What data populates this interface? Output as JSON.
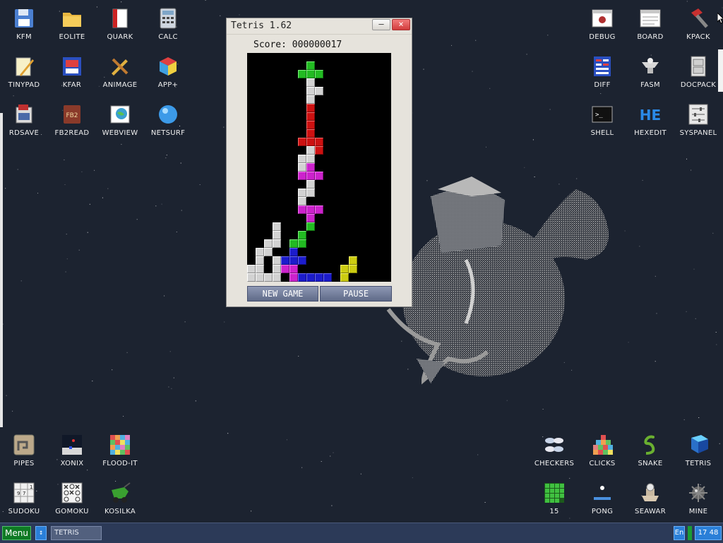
{
  "desktop": {
    "icons_top_left": [
      {
        "label": "KFM",
        "icon": "floppy-disk-icon"
      },
      {
        "label": "EOLITE",
        "icon": "folder-icon"
      },
      {
        "label": "QUARK",
        "icon": "red-book-icon"
      },
      {
        "label": "CALC",
        "icon": "calculator-icon"
      },
      {
        "label": "TINYPAD",
        "icon": "notepad-pencil-icon"
      },
      {
        "label": "KFAR",
        "icon": "archive-grid-icon"
      },
      {
        "label": "ANIMAGE",
        "icon": "pencil-ruler-icon"
      },
      {
        "label": "APP+",
        "icon": "rubik-cube-icon"
      },
      {
        "label": "RDSAVE",
        "icon": "ram-disk-icon"
      },
      {
        "label": "FB2READ",
        "icon": "fb2-book-icon"
      },
      {
        "label": "WEBVIEW",
        "icon": "web-image-icon"
      },
      {
        "label": "NETSURF",
        "icon": "globe-icon"
      }
    ],
    "icons_top_right": [
      {
        "label": "DEBUG",
        "icon": "bug-window-icon"
      },
      {
        "label": "BOARD",
        "icon": "board-window-icon"
      },
      {
        "label": "KPACK",
        "icon": "hammer-icon"
      },
      {
        "label": "DIFF",
        "icon": "diff-table-icon"
      },
      {
        "label": "FASM",
        "icon": "fasm-anvil-icon"
      },
      {
        "label": "DOCPACK",
        "icon": "cabinet-icon"
      },
      {
        "label": "SHELL",
        "icon": "terminal-icon"
      },
      {
        "label": "HEXEDIT",
        "icon": "hex-editor-icon"
      },
      {
        "label": "SYSPANEL",
        "icon": "sliders-panel-icon"
      }
    ],
    "icons_bottom_left": [
      {
        "label": "PIPES",
        "icon": "pipes-game-icon"
      },
      {
        "label": "XONIX",
        "icon": "xonix-game-icon"
      },
      {
        "label": "FLOOD-IT",
        "icon": "flood-it-game-icon"
      },
      {
        "label": "SUDOKU",
        "icon": "sudoku-grid-icon"
      },
      {
        "label": "GOMOKU",
        "icon": "gomoku-board-icon"
      },
      {
        "label": "KOSILKA",
        "icon": "lawnmower-icon"
      }
    ],
    "icons_bottom_right": [
      {
        "label": "CHECKERS",
        "icon": "checkers-pieces-icon"
      },
      {
        "label": "CLICKS",
        "icon": "clicks-blocks-icon"
      },
      {
        "label": "SNAKE",
        "icon": "snake-icon"
      },
      {
        "label": "TETRIS",
        "icon": "tetris-cube-icon"
      },
      {
        "label": "15",
        "icon": "fifteen-puzzle-icon"
      },
      {
        "label": "PONG",
        "icon": "pong-paddle-icon"
      },
      {
        "label": "SEAWAR",
        "icon": "seawar-ship-icon"
      },
      {
        "label": "MINE",
        "icon": "mine-icon"
      }
    ]
  },
  "tetris_window": {
    "title": "Tetris 1.62",
    "minimize_label": "–",
    "close_label": "×",
    "score_label": "Score:",
    "score_value": "000000017",
    "new_game_label": "NEW GAME",
    "pause_label": "PAUSE",
    "board": {
      "columns": 17,
      "rows": 27,
      "cells": [
        {
          "col": 7,
          "row": 1,
          "color": "green"
        },
        {
          "col": 6,
          "row": 2,
          "color": "green"
        },
        {
          "col": 7,
          "row": 2,
          "color": "green"
        },
        {
          "col": 8,
          "row": 2,
          "color": "green"
        },
        {
          "col": 7,
          "row": 3,
          "color": "white"
        },
        {
          "col": 7,
          "row": 4,
          "color": "white"
        },
        {
          "col": 8,
          "row": 4,
          "color": "white"
        },
        {
          "col": 7,
          "row": 5,
          "color": "white"
        },
        {
          "col": 7,
          "row": 6,
          "color": "red"
        },
        {
          "col": 7,
          "row": 7,
          "color": "red"
        },
        {
          "col": 7,
          "row": 8,
          "color": "red"
        },
        {
          "col": 7,
          "row": 9,
          "color": "red"
        },
        {
          "col": 6,
          "row": 10,
          "color": "red"
        },
        {
          "col": 7,
          "row": 10,
          "color": "red"
        },
        {
          "col": 8,
          "row": 10,
          "color": "red"
        },
        {
          "col": 8,
          "row": 11,
          "color": "red"
        },
        {
          "col": 7,
          "row": 11,
          "color": "white"
        },
        {
          "col": 6,
          "row": 12,
          "color": "white"
        },
        {
          "col": 7,
          "row": 12,
          "color": "white"
        },
        {
          "col": 6,
          "row": 13,
          "color": "white"
        },
        {
          "col": 7,
          "row": 13,
          "color": "magenta"
        },
        {
          "col": 6,
          "row": 14,
          "color": "magenta"
        },
        {
          "col": 7,
          "row": 14,
          "color": "magenta"
        },
        {
          "col": 8,
          "row": 14,
          "color": "magenta"
        },
        {
          "col": 7,
          "row": 15,
          "color": "white"
        },
        {
          "col": 6,
          "row": 16,
          "color": "white"
        },
        {
          "col": 7,
          "row": 16,
          "color": "white"
        },
        {
          "col": 6,
          "row": 17,
          "color": "white"
        },
        {
          "col": 6,
          "row": 18,
          "color": "magenta"
        },
        {
          "col": 7,
          "row": 18,
          "color": "magenta"
        },
        {
          "col": 8,
          "row": 18,
          "color": "magenta"
        },
        {
          "col": 7,
          "row": 19,
          "color": "magenta"
        },
        {
          "col": 7,
          "row": 20,
          "color": "green"
        },
        {
          "col": 6,
          "row": 21,
          "color": "green"
        },
        {
          "col": 5,
          "row": 22,
          "color": "green"
        },
        {
          "col": 6,
          "row": 22,
          "color": "green"
        },
        {
          "col": 3,
          "row": 20,
          "color": "white"
        },
        {
          "col": 3,
          "row": 21,
          "color": "white"
        },
        {
          "col": 2,
          "row": 22,
          "color": "white"
        },
        {
          "col": 3,
          "row": 22,
          "color": "white"
        },
        {
          "col": 2,
          "row": 23,
          "color": "white"
        },
        {
          "col": 1,
          "row": 23,
          "color": "white"
        },
        {
          "col": 1,
          "row": 24,
          "color": "white"
        },
        {
          "col": 0,
          "row": 25,
          "color": "white"
        },
        {
          "col": 1,
          "row": 25,
          "color": "white"
        },
        {
          "col": 3,
          "row": 25,
          "color": "white"
        },
        {
          "col": 0,
          "row": 26,
          "color": "white"
        },
        {
          "col": 1,
          "row": 26,
          "color": "white"
        },
        {
          "col": 2,
          "row": 26,
          "color": "white"
        },
        {
          "col": 3,
          "row": 26,
          "color": "white"
        },
        {
          "col": 3,
          "row": 24,
          "color": "white"
        },
        {
          "col": 5,
          "row": 23,
          "color": "blue"
        },
        {
          "col": 4,
          "row": 24,
          "color": "blue"
        },
        {
          "col": 5,
          "row": 24,
          "color": "blue"
        },
        {
          "col": 6,
          "row": 24,
          "color": "blue"
        },
        {
          "col": 5,
          "row": 25,
          "color": "magenta"
        },
        {
          "col": 4,
          "row": 25,
          "color": "magenta"
        },
        {
          "col": 5,
          "row": 26,
          "color": "magenta"
        },
        {
          "col": 6,
          "row": 26,
          "color": "blue"
        },
        {
          "col": 7,
          "row": 26,
          "color": "blue"
        },
        {
          "col": 8,
          "row": 26,
          "color": "blue"
        },
        {
          "col": 9,
          "row": 26,
          "color": "blue"
        },
        {
          "col": 12,
          "row": 24,
          "color": "yellow"
        },
        {
          "col": 11,
          "row": 25,
          "color": "yellow"
        },
        {
          "col": 12,
          "row": 25,
          "color": "yellow"
        },
        {
          "col": 11,
          "row": 26,
          "color": "yellow"
        }
      ]
    }
  },
  "taskbar": {
    "menu_label": "Menu",
    "switch_label": "↕",
    "task_label": "TETRIS",
    "lang_label": "En",
    "clock": "17 48"
  },
  "colors": {
    "desktop_bg": "#1c2330",
    "taskbar_bg": "#2c3a58",
    "menu_green": "#0e7a24",
    "tray_blue": "#2a7fd8"
  }
}
